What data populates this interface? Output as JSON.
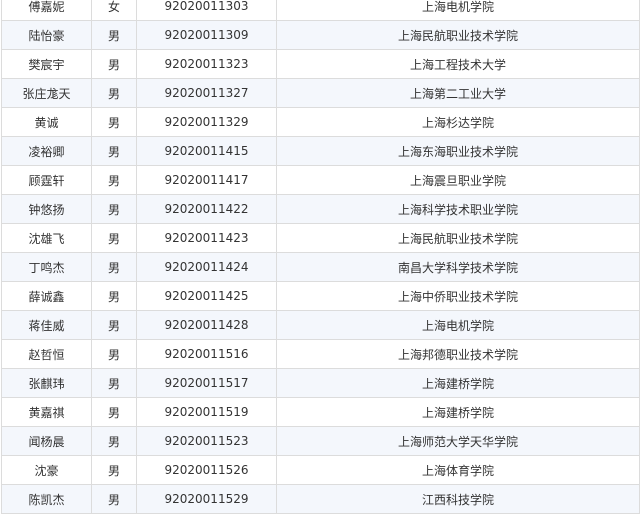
{
  "rows": [
    {
      "name": "傅嘉妮",
      "gender": "女",
      "id": "92020011303",
      "school": "上海电机学院"
    },
    {
      "name": "陆怡豪",
      "gender": "男",
      "id": "92020011309",
      "school": "上海民航职业技术学院"
    },
    {
      "name": "樊宸宇",
      "gender": "男",
      "id": "92020011323",
      "school": "上海工程技术大学"
    },
    {
      "name": "张庄尨天",
      "gender": "男",
      "id": "92020011327",
      "school": "上海第二工业大学"
    },
    {
      "name": "黄诚",
      "gender": "男",
      "id": "92020011329",
      "school": "上海杉达学院"
    },
    {
      "name": "凌裕卿",
      "gender": "男",
      "id": "92020011415",
      "school": "上海东海职业技术学院"
    },
    {
      "name": "顾霆轩",
      "gender": "男",
      "id": "92020011417",
      "school": "上海震旦职业学院"
    },
    {
      "name": "钟悠扬",
      "gender": "男",
      "id": "92020011422",
      "school": "上海科学技术职业学院"
    },
    {
      "name": "沈雄飞",
      "gender": "男",
      "id": "92020011423",
      "school": "上海民航职业技术学院"
    },
    {
      "name": "丁鸣杰",
      "gender": "男",
      "id": "92020011424",
      "school": "南昌大学科学技术学院"
    },
    {
      "name": "薛诚鑫",
      "gender": "男",
      "id": "92020011425",
      "school": "上海中侨职业技术学院"
    },
    {
      "name": "蒋佳威",
      "gender": "男",
      "id": "92020011428",
      "school": "上海电机学院"
    },
    {
      "name": "赵哲恒",
      "gender": "男",
      "id": "92020011516",
      "school": "上海邦德职业技术学院"
    },
    {
      "name": "张麒玮",
      "gender": "男",
      "id": "92020011517",
      "school": "上海建桥学院"
    },
    {
      "name": "黄嘉祺",
      "gender": "男",
      "id": "92020011519",
      "school": "上海建桥学院"
    },
    {
      "name": "闻杨晨",
      "gender": "男",
      "id": "92020011523",
      "school": "上海师范大学天华学院"
    },
    {
      "name": "沈豪",
      "gender": "男",
      "id": "92020011526",
      "school": "上海体育学院"
    },
    {
      "name": "陈凯杰",
      "gender": "男",
      "id": "92020011529",
      "school": "江西科技学院"
    }
  ]
}
